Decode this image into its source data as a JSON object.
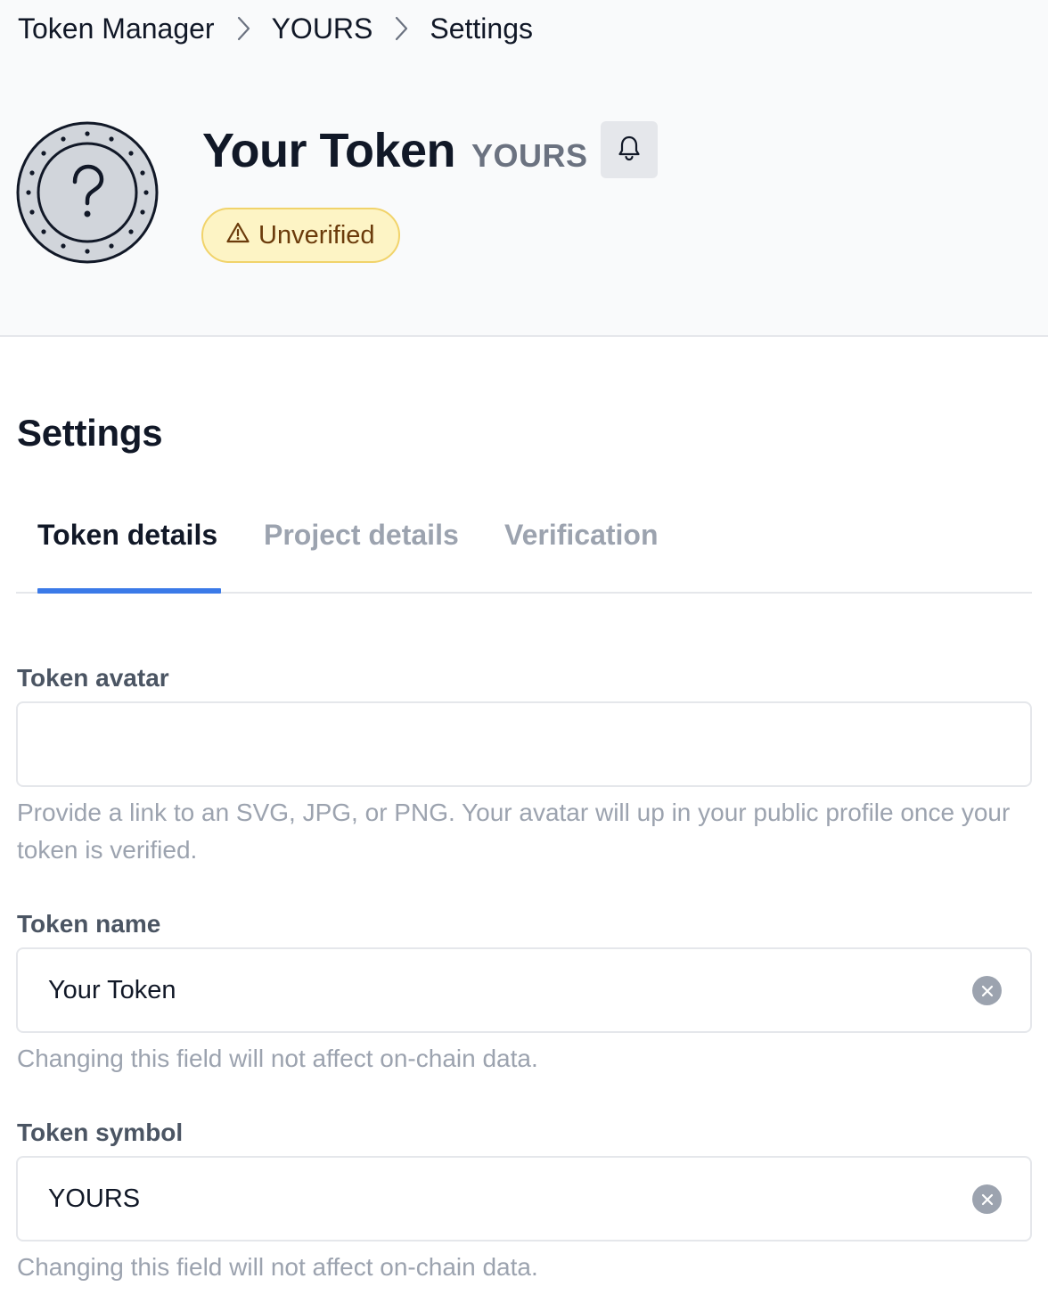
{
  "breadcrumb": {
    "items": [
      "Token Manager",
      "YOURS",
      "Settings"
    ],
    "separator_icon": "chevron-right-icon"
  },
  "token": {
    "name": "Your Token",
    "symbol": "YOURS",
    "avatar_icon": "question-mark-coin-icon",
    "status": "Unverified",
    "status_icon": "warning-triangle-icon",
    "notification_icon": "bell-icon"
  },
  "settings": {
    "title": "Settings",
    "tabs": [
      {
        "label": "Token details",
        "active": true
      },
      {
        "label": "Project details",
        "active": false
      },
      {
        "label": "Verification",
        "active": false
      }
    ]
  },
  "form": {
    "avatar": {
      "label": "Token avatar",
      "value": "",
      "help": "Provide a link to an SVG, JPG, or PNG. Your avatar will up in your public profile once your token is verified."
    },
    "name": {
      "label": "Token name",
      "value": "Your Token",
      "help": "Changing this field will not affect on-chain data.",
      "clear_icon": "clear-icon"
    },
    "symbol": {
      "label": "Token symbol",
      "value": "YOURS",
      "help": "Changing this field will not affect on-chain data.",
      "clear_icon": "clear-icon"
    }
  },
  "colors": {
    "header_bg": "#f9fafb",
    "accent": "#3b7ae8",
    "badge_bg": "#fdf4c5",
    "badge_border": "#f1d36a",
    "badge_text": "#6b3b0b",
    "muted_text": "#9ca3af"
  }
}
